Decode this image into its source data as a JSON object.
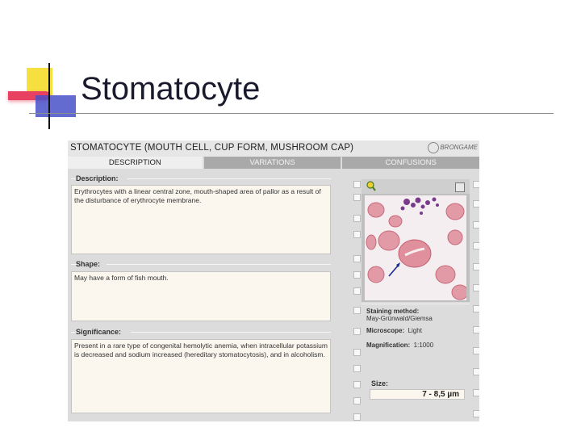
{
  "slide": {
    "title": "Stomatocyte"
  },
  "app": {
    "header_title": "STOMATOCYTE (MOUTH CELL, CUP FORM, MUSHROOM CAP)",
    "logo_text": "BRONGAME",
    "tabs": [
      {
        "label": "DESCRIPTION",
        "active": true
      },
      {
        "label": "VARIATIONS",
        "active": false
      },
      {
        "label": "CONFUSIONS",
        "active": false
      }
    ],
    "sections": {
      "description": {
        "label": "Description:",
        "text": "Erythrocytes with a linear central zone, mouth-shaped area of pallor as a result of the disturbance of erythrocyte membrane."
      },
      "shape": {
        "label": "Shape:",
        "text": "May have a form of fish mouth."
      },
      "significance": {
        "label": "Significance:",
        "text": "Present in a rare type of congenital hemolytic anemia, when intracellular potassium is decreased and sodium increased (hereditary stomatocytosis), and in alcoholism."
      }
    },
    "image_info": {
      "staining_label": "Staining method:",
      "staining_value": "May-Grünwald/Giemsa",
      "microscope_label": "Microscope:",
      "microscope_value": "Light",
      "magnification_label": "Magnification:",
      "magnification_value": "1:1000"
    },
    "size": {
      "label": "Size:",
      "value": "7 - 8,5  µm"
    },
    "icons": {
      "tool": "magnifier-icon",
      "grid": "grid-icon"
    }
  }
}
